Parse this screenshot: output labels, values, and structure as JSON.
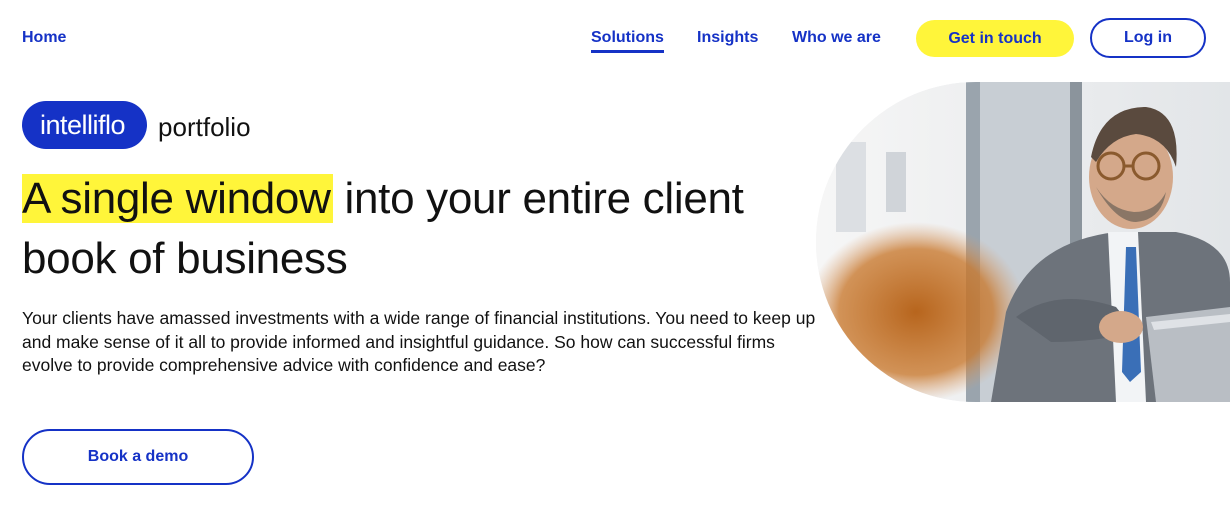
{
  "nav": {
    "home": "Home",
    "solutions": "Solutions",
    "insights": "Insights",
    "who_we_are": "Who we are",
    "get_in_touch": "Get in touch",
    "log_in": "Log in"
  },
  "brand": {
    "logo": "intelliflo",
    "product": "portfolio"
  },
  "hero": {
    "headline_highlight": "A single window",
    "headline_rest": " into your entire client book of business",
    "body": "Your clients have amassed investments with a wide range of financial institutions. You need to keep up and make sense of it all to provide informed and insightful guidance. So how can successful firms evolve to provide comprehensive advice with confidence and ease?",
    "cta": "Book a demo",
    "image_icon": "photo-businessman-laptop"
  },
  "colors": {
    "accent_blue": "#1532c6",
    "highlight_yellow": "#fff53a"
  }
}
